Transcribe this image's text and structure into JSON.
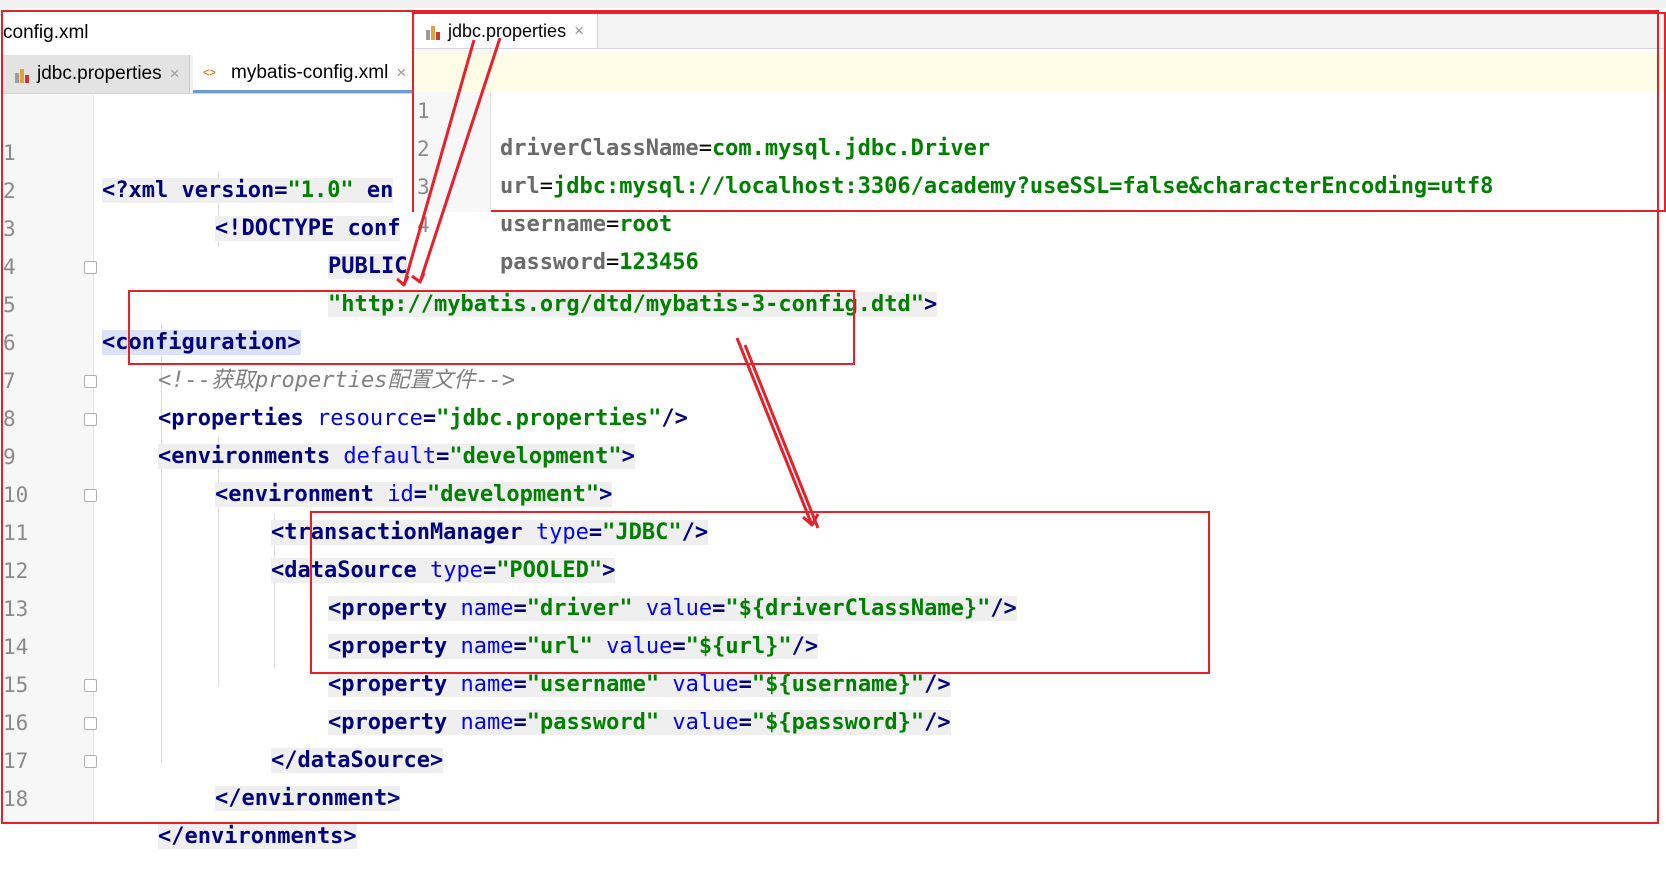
{
  "window": {
    "title": "config.xml"
  },
  "tabs": [
    {
      "label": "jdbc.properties",
      "icon": "properties-file-icon",
      "active": false
    },
    {
      "label": "mybatis-config.xml",
      "icon": "xml-file-icon",
      "active": true
    }
  ],
  "editor": {
    "lines": [
      {
        "num": "1"
      },
      {
        "num": "2"
      },
      {
        "num": "3"
      },
      {
        "num": "4"
      },
      {
        "num": "5"
      },
      {
        "num": "6"
      },
      {
        "num": "7"
      },
      {
        "num": "8"
      },
      {
        "num": "9"
      },
      {
        "num": "10"
      },
      {
        "num": "11"
      },
      {
        "num": "12"
      },
      {
        "num": "13"
      },
      {
        "num": "14"
      },
      {
        "num": "15"
      },
      {
        "num": "16"
      },
      {
        "num": "17"
      },
      {
        "num": "18"
      }
    ],
    "tokens": {
      "l1": [
        "<?",
        "xml version",
        "=",
        "\"1.0\"",
        " en"
      ],
      "l2": [
        "<!DOCTYPE",
        " conf"
      ],
      "l3": [
        "PUBLIC"
      ],
      "l4": [
        "\"http://mybatis.org/dtd/mybatis-3-config.dtd\"",
        ">"
      ],
      "l5": [
        "<configuration>"
      ],
      "l6": [
        "<!--获取properties配置文件-->"
      ],
      "l7": [
        "<properties",
        " resource",
        "=",
        "\"jdbc.properties\"",
        "/>"
      ],
      "l8": [
        "<environments",
        " default",
        "=",
        "\"development\"",
        ">"
      ],
      "l9": [
        "<environment",
        " id",
        "=",
        "\"development\"",
        ">"
      ],
      "l10": [
        "<transactionManager",
        " type",
        "=",
        "\"JDBC\"",
        "/>"
      ],
      "l11": [
        "<dataSource",
        " type",
        "=",
        "\"POOLED\"",
        ">"
      ],
      "l12": [
        "<property",
        " name",
        "=",
        "\"driver\"",
        " value",
        "=",
        "\"${driverClassName}\"",
        "/>"
      ],
      "l13": [
        "<property",
        " name",
        "=",
        "\"url\"",
        " value",
        "=",
        "\"${url}\"",
        "/>"
      ],
      "l14": [
        "<property",
        " name",
        "=",
        "\"username\"",
        " value",
        "=",
        "\"${username}\"",
        "/>"
      ],
      "l15": [
        "<property",
        " name",
        "=",
        "\"password\"",
        " value",
        "=",
        "\"${password}\"",
        "/>"
      ],
      "l16": [
        "</dataSource>"
      ],
      "l17": [
        "</environment>"
      ],
      "l18": [
        "</environments>"
      ]
    }
  },
  "popup": {
    "tab_label": "jdbc.properties",
    "lines": [
      {
        "num": "1",
        "key": "driverClassName",
        "eq": "=",
        "value": "com.mysql.jdbc.Driver"
      },
      {
        "num": "2",
        "key": "url",
        "eq": "=",
        "value": "jdbc:mysql://localhost:3306/academy?useSSL=false&characterEncoding=utf8"
      },
      {
        "num": "3",
        "key": "username",
        "eq": "=",
        "value": "root"
      },
      {
        "num": "4",
        "key": "password",
        "eq": "=",
        "value": "123456"
      }
    ]
  },
  "colors": {
    "annotation": "#e8202a",
    "tag": "#000080",
    "attribute": "#0000ff",
    "value": "#008000",
    "comment": "#808080"
  },
  "close_glyph": "×"
}
